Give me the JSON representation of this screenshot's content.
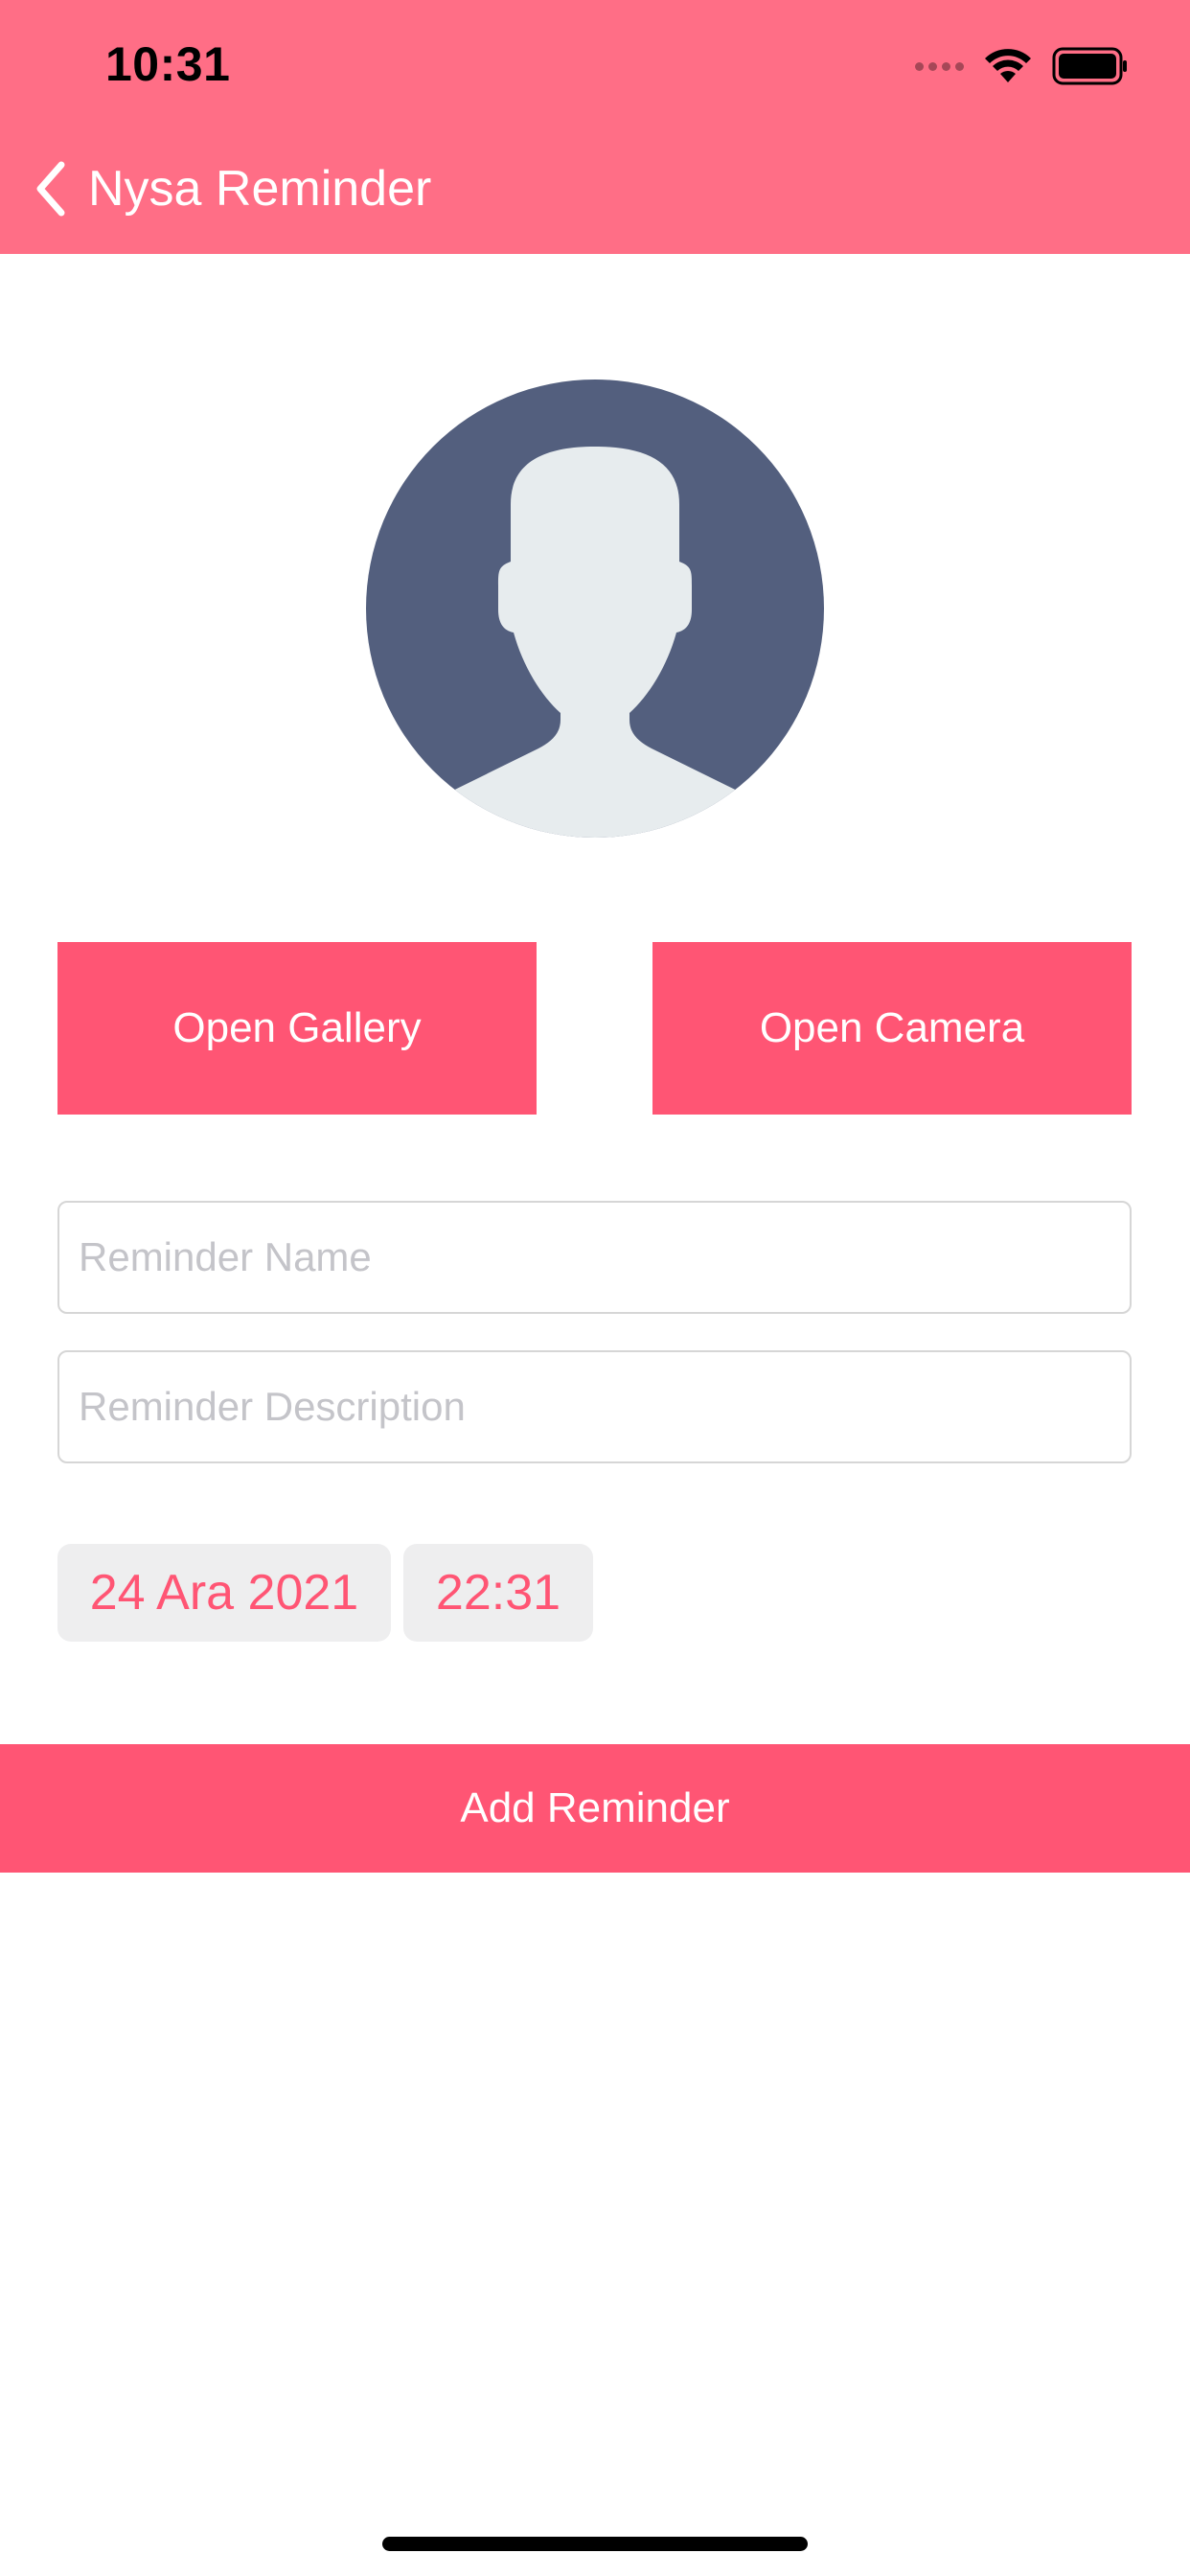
{
  "status_bar": {
    "time": "10:31"
  },
  "nav": {
    "title": "Nysa Reminder",
    "back_icon": "chevron-left-icon"
  },
  "colors": {
    "header": "#ff6e86",
    "accent": "#ff5574",
    "avatar_bg": "#535f7e",
    "avatar_figure": "#e7ecee"
  },
  "avatar": {
    "icon": "user-placeholder-icon"
  },
  "buttons": {
    "open_gallery": "Open Gallery",
    "open_camera": "Open Camera",
    "add_reminder": "Add Reminder"
  },
  "form": {
    "name_placeholder": "Reminder Name",
    "description_placeholder": "Reminder Description",
    "date": "24 Ara 2021",
    "time": "22:31"
  }
}
